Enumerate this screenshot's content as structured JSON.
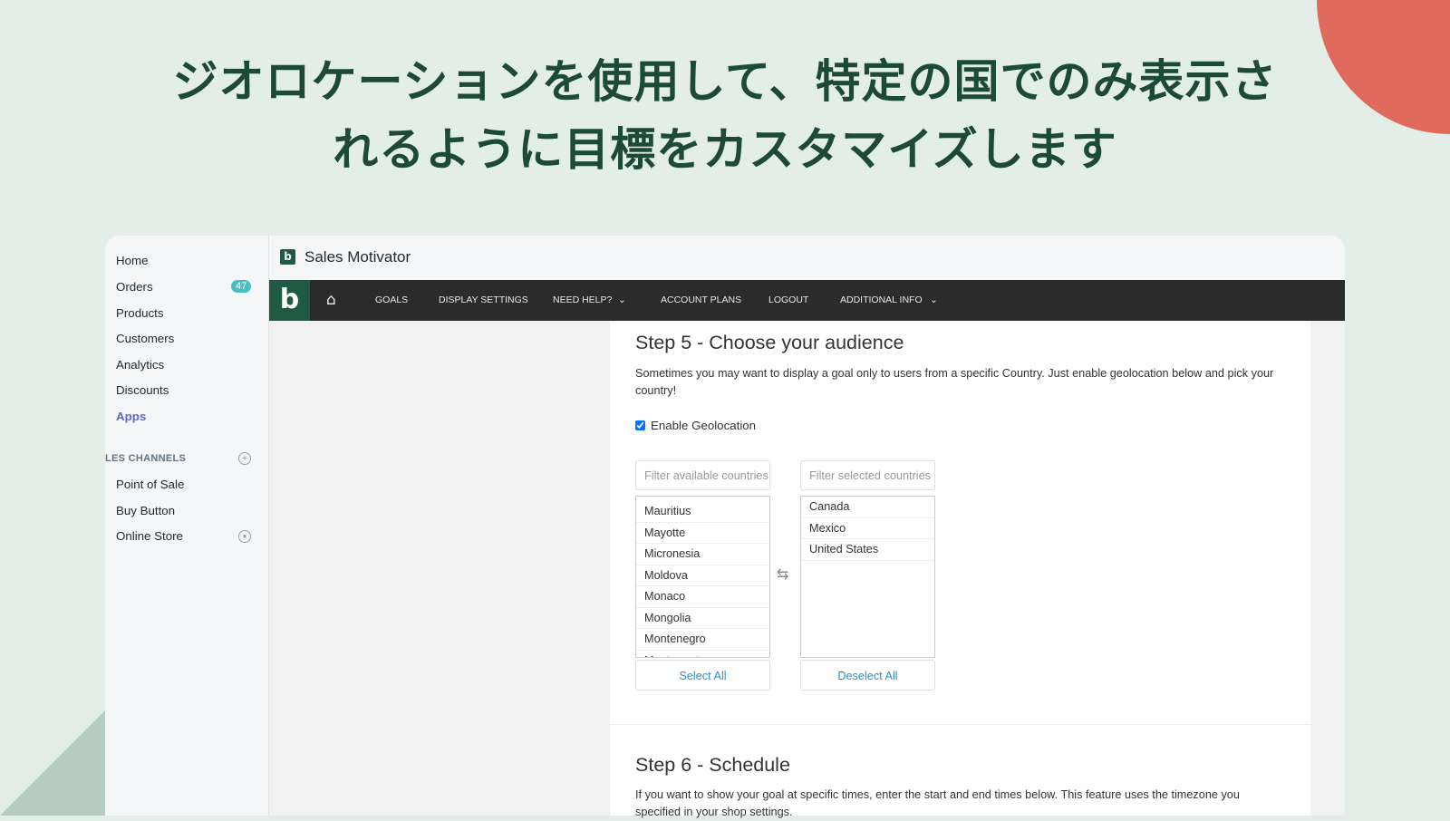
{
  "headline": {
    "line1": "ジオロケーションを使用して、特定の国でのみ表示さ",
    "line2": "れるように目標をカスタマイズします"
  },
  "colors": {
    "background": "#e3eee8",
    "headline": "#1d4a38",
    "accent_circle": "#e06a5c",
    "brand_green": "#1f5a43",
    "nav": "#2b2b2b",
    "link": "#2e8ec4"
  },
  "sidebar": {
    "items": [
      {
        "label": "Home"
      },
      {
        "label": "Orders",
        "badge": "47"
      },
      {
        "label": "Products"
      },
      {
        "label": "Customers"
      },
      {
        "label": "Analytics"
      },
      {
        "label": "Discounts"
      },
      {
        "label": "Apps",
        "active": true
      }
    ],
    "section_title": "LES CHANNELS",
    "channels": [
      {
        "label": "Point of Sale"
      },
      {
        "label": "Buy Button"
      },
      {
        "label": "Online Store",
        "icon": "eye-icon"
      }
    ]
  },
  "app": {
    "logo": "b",
    "title": "Sales Motivator"
  },
  "nav": {
    "logo": "b",
    "items": [
      "GOALS",
      "DISPLAY SETTINGS",
      "NEED HELP?",
      "ACCOUNT PLANS",
      "LOGOUT",
      "ADDITIONAL INFO"
    ]
  },
  "step5": {
    "title": "Step 5 - Choose your audience",
    "description": "Sometimes you may want to display a goal only to users from a specific Country. Just enable geolocation below and pick your country!",
    "geolocation_label": "Enable Geolocation",
    "geolocation_checked": true,
    "available_placeholder": "Filter available countries",
    "selected_placeholder": "Filter selected countries",
    "available": [
      "Mauritius",
      "Mayotte",
      "Micronesia",
      "Moldova",
      "Monaco",
      "Mongolia",
      "Montenegro",
      "Montserrat"
    ],
    "selected": [
      "Canada",
      "Mexico",
      "United States"
    ],
    "select_all": "Select All",
    "deselect_all": "Deselect All"
  },
  "step6": {
    "title": "Step 6 - Schedule",
    "description": "If you want to show your goal at specific times, enter the start and end times below. This feature uses the timezone you specified in your shop settings."
  }
}
